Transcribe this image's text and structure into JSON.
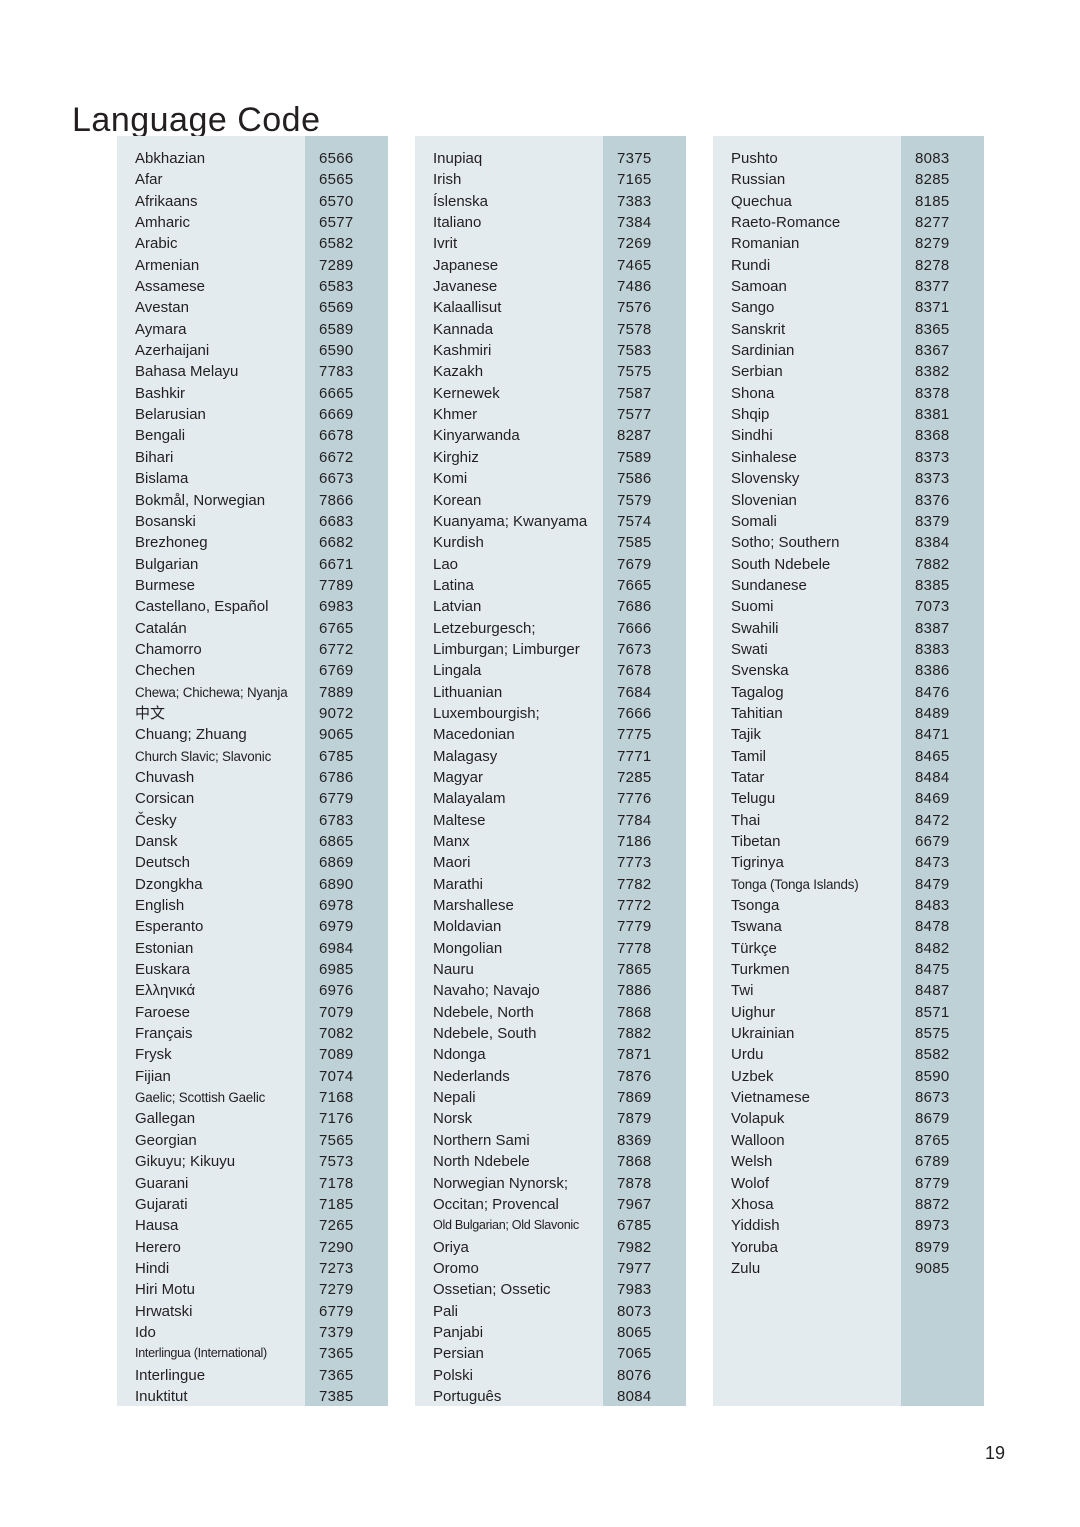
{
  "page": {
    "title": "Language Code",
    "page_number": "19",
    "colors": {
      "name_cell_bg": "#e3ebef",
      "code_cell_bg": "#bdd1d7",
      "text": "#231f20",
      "page_bg": "#ffffff"
    }
  },
  "table": {
    "columns": [
      {
        "id": "column-1",
        "rows": [
          {
            "name": "Abkhazian",
            "code": "6566"
          },
          {
            "name": "Afar",
            "code": "6565"
          },
          {
            "name": "Afrikaans",
            "code": "6570"
          },
          {
            "name": "Amharic",
            "code": "6577"
          },
          {
            "name": "Arabic",
            "code": "6582"
          },
          {
            "name": "Armenian",
            "code": "7289"
          },
          {
            "name": "Assamese",
            "code": "6583"
          },
          {
            "name": "Avestan",
            "code": "6569"
          },
          {
            "name": "Aymara",
            "code": "6589"
          },
          {
            "name": "Azerhaijani",
            "code": "6590"
          },
          {
            "name": "Bahasa Melayu",
            "code": "7783"
          },
          {
            "name": "Bashkir",
            "code": "6665"
          },
          {
            "name": "Belarusian",
            "code": "6669"
          },
          {
            "name": "Bengali",
            "code": "6678"
          },
          {
            "name": "Bihari",
            "code": "6672"
          },
          {
            "name": "Bislama",
            "code": "6673"
          },
          {
            "name": "Bokmål, Norwegian",
            "code": "7866"
          },
          {
            "name": "Bosanski",
            "code": "6683"
          },
          {
            "name": "Brezhoneg",
            "code": "6682"
          },
          {
            "name": "Bulgarian",
            "code": "6671"
          },
          {
            "name": "Burmese",
            "code": "7789"
          },
          {
            "name": "Castellano, Español",
            "code": "6983"
          },
          {
            "name": "Catalán",
            "code": "6765"
          },
          {
            "name": "Chamorro",
            "code": "6772"
          },
          {
            "name": "Chechen",
            "code": "6769"
          },
          {
            "name": "Chewa; Chichewa; Nyanja",
            "code": "7889"
          },
          {
            "name": "中文",
            "code": "9072"
          },
          {
            "name": "Chuang; Zhuang",
            "code": "9065"
          },
          {
            "name": "Church Slavic; Slavonic",
            "code": "6785"
          },
          {
            "name": "Chuvash",
            "code": "6786"
          },
          {
            "name": "Corsican",
            "code": "6779"
          },
          {
            "name": "Česky",
            "code": "6783"
          },
          {
            "name": "Dansk",
            "code": "6865"
          },
          {
            "name": "Deutsch",
            "code": "6869"
          },
          {
            "name": "Dzongkha",
            "code": "6890"
          },
          {
            "name": "English",
            "code": "6978"
          },
          {
            "name": "Esperanto",
            "code": "6979"
          },
          {
            "name": "Estonian",
            "code": "6984"
          },
          {
            "name": "Euskara",
            "code": "6985"
          },
          {
            "name": "Ελληνικά",
            "code": "6976"
          },
          {
            "name": "Faroese",
            "code": "7079"
          },
          {
            "name": "Français",
            "code": "7082"
          },
          {
            "name": "Frysk",
            "code": "7089"
          },
          {
            "name": "Fijian",
            "code": "7074"
          },
          {
            "name": "Gaelic; Scottish Gaelic",
            "code": "7168"
          },
          {
            "name": "Gallegan",
            "code": "7176"
          },
          {
            "name": "Georgian",
            "code": "7565"
          },
          {
            "name": "Gikuyu; Kikuyu",
            "code": "7573"
          },
          {
            "name": "Guarani",
            "code": "7178"
          },
          {
            "name": "Gujarati",
            "code": "7185"
          },
          {
            "name": "Hausa",
            "code": "7265"
          },
          {
            "name": "Herero",
            "code": "7290"
          },
          {
            "name": "Hindi",
            "code": "7273"
          },
          {
            "name": "Hiri Motu",
            "code": "7279"
          },
          {
            "name": "Hrwatski",
            "code": "6779"
          },
          {
            "name": "Ido",
            "code": "7379"
          },
          {
            "name": "Interlingua (International)",
            "code": "7365"
          },
          {
            "name": "Interlingue",
            "code": "7365"
          },
          {
            "name": "Inuktitut",
            "code": "7385"
          }
        ]
      },
      {
        "id": "column-2",
        "rows": [
          {
            "name": "Inupiaq",
            "code": "7375"
          },
          {
            "name": "Irish",
            "code": "7165"
          },
          {
            "name": "Íslenska",
            "code": "7383"
          },
          {
            "name": "Italiano",
            "code": "7384"
          },
          {
            "name": "Ivrit",
            "code": "7269"
          },
          {
            "name": "Japanese",
            "code": "7465"
          },
          {
            "name": "Javanese",
            "code": "7486"
          },
          {
            "name": "Kalaallisut",
            "code": "7576"
          },
          {
            "name": "Kannada",
            "code": "7578"
          },
          {
            "name": "Kashmiri",
            "code": "7583"
          },
          {
            "name": "Kazakh",
            "code": "7575"
          },
          {
            "name": "Kernewek",
            "code": "7587"
          },
          {
            "name": "Khmer",
            "code": "7577"
          },
          {
            "name": "Kinyarwanda",
            "code": "8287"
          },
          {
            "name": "Kirghiz",
            "code": "7589"
          },
          {
            "name": "Komi",
            "code": "7586"
          },
          {
            "name": "Korean",
            "code": "7579"
          },
          {
            "name": "Kuanyama; Kwanyama",
            "code": "7574"
          },
          {
            "name": "Kurdish",
            "code": "7585"
          },
          {
            "name": "Lao",
            "code": "7679"
          },
          {
            "name": "Latina",
            "code": "7665"
          },
          {
            "name": "Latvian",
            "code": "7686"
          },
          {
            "name": "Letzeburgesch;",
            "code": "7666"
          },
          {
            "name": "Limburgan; Limburger",
            "code": "7673"
          },
          {
            "name": "Lingala",
            "code": "7678"
          },
          {
            "name": "Lithuanian",
            "code": "7684"
          },
          {
            "name": "Luxembourgish;",
            "code": "7666"
          },
          {
            "name": "Macedonian",
            "code": "7775"
          },
          {
            "name": "Malagasy",
            "code": "7771"
          },
          {
            "name": "Magyar",
            "code": "7285"
          },
          {
            "name": "Malayalam",
            "code": "7776"
          },
          {
            "name": "Maltese",
            "code": "7784"
          },
          {
            "name": "Manx",
            "code": "7186"
          },
          {
            "name": "Maori",
            "code": "7773"
          },
          {
            "name": "Marathi",
            "code": "7782"
          },
          {
            "name": "Marshallese",
            "code": "7772"
          },
          {
            "name": "Moldavian",
            "code": "7779"
          },
          {
            "name": "Mongolian",
            "code": "7778"
          },
          {
            "name": "Nauru",
            "code": "7865"
          },
          {
            "name": "Navaho; Navajo",
            "code": "7886"
          },
          {
            "name": "Ndebele, North",
            "code": "7868"
          },
          {
            "name": "Ndebele, South",
            "code": "7882"
          },
          {
            "name": "Ndonga",
            "code": "7871"
          },
          {
            "name": "Nederlands",
            "code": "7876"
          },
          {
            "name": "Nepali",
            "code": "7869"
          },
          {
            "name": "Norsk",
            "code": "7879"
          },
          {
            "name": "Northern Sami",
            "code": "8369"
          },
          {
            "name": "North Ndebele",
            "code": "7868"
          },
          {
            "name": "Norwegian Nynorsk;",
            "code": "7878"
          },
          {
            "name": "Occitan; Provencal",
            "code": "7967"
          },
          {
            "name": "Old Bulgarian; Old Slavonic",
            "code": "6785"
          },
          {
            "name": "Oriya",
            "code": "7982"
          },
          {
            "name": "Oromo",
            "code": "7977"
          },
          {
            "name": "Ossetian; Ossetic",
            "code": "7983"
          },
          {
            "name": "Pali",
            "code": "8073"
          },
          {
            "name": "Panjabi",
            "code": "8065"
          },
          {
            "name": "Persian",
            "code": "7065"
          },
          {
            "name": "Polski",
            "code": "8076"
          },
          {
            "name": "Português",
            "code": "8084"
          }
        ]
      },
      {
        "id": "column-3",
        "rows": [
          {
            "name": "Pushto",
            "code": "8083"
          },
          {
            "name": "Russian",
            "code": "8285"
          },
          {
            "name": "Quechua",
            "code": "8185"
          },
          {
            "name": "Raeto-Romance",
            "code": "8277"
          },
          {
            "name": "Romanian",
            "code": "8279"
          },
          {
            "name": "Rundi",
            "code": "8278"
          },
          {
            "name": "Samoan",
            "code": "8377"
          },
          {
            "name": "Sango",
            "code": "8371"
          },
          {
            "name": "Sanskrit",
            "code": "8365"
          },
          {
            "name": "Sardinian",
            "code": "8367"
          },
          {
            "name": "Serbian",
            "code": "8382"
          },
          {
            "name": "Shona",
            "code": "8378"
          },
          {
            "name": "Shqip",
            "code": "8381"
          },
          {
            "name": "Sindhi",
            "code": "8368"
          },
          {
            "name": "Sinhalese",
            "code": "8373"
          },
          {
            "name": "Slovensky",
            "code": "8373"
          },
          {
            "name": "Slovenian",
            "code": "8376"
          },
          {
            "name": "Somali",
            "code": "8379"
          },
          {
            "name": "Sotho; Southern",
            "code": "8384"
          },
          {
            "name": "South Ndebele",
            "code": "7882"
          },
          {
            "name": "Sundanese",
            "code": "8385"
          },
          {
            "name": "Suomi",
            "code": "7073"
          },
          {
            "name": "Swahili",
            "code": "8387"
          },
          {
            "name": "Swati",
            "code": "8383"
          },
          {
            "name": "Svenska",
            "code": "8386"
          },
          {
            "name": "Tagalog",
            "code": "8476"
          },
          {
            "name": "Tahitian",
            "code": "8489"
          },
          {
            "name": "Tajik",
            "code": "8471"
          },
          {
            "name": "Tamil",
            "code": "8465"
          },
          {
            "name": "Tatar",
            "code": "8484"
          },
          {
            "name": "Telugu",
            "code": "8469"
          },
          {
            "name": "Thai",
            "code": "8472"
          },
          {
            "name": "Tibetan",
            "code": "6679"
          },
          {
            "name": "Tigrinya",
            "code": "8473"
          },
          {
            "name": "Tonga (Tonga Islands)",
            "code": "8479"
          },
          {
            "name": "Tsonga",
            "code": "8483"
          },
          {
            "name": "Tswana",
            "code": "8478"
          },
          {
            "name": "Türkçe",
            "code": "8482"
          },
          {
            "name": "Turkmen",
            "code": "8475"
          },
          {
            "name": "Twi",
            "code": "8487"
          },
          {
            "name": "Uighur",
            "code": "8571"
          },
          {
            "name": "Ukrainian",
            "code": "8575"
          },
          {
            "name": "Urdu",
            "code": "8582"
          },
          {
            "name": "Uzbek",
            "code": "8590"
          },
          {
            "name": "Vietnamese",
            "code": "8673"
          },
          {
            "name": "Volapuk",
            "code": "8679"
          },
          {
            "name": "Walloon",
            "code": "8765"
          },
          {
            "name": "Welsh",
            "code": "6789"
          },
          {
            "name": "Wolof",
            "code": "8779"
          },
          {
            "name": "Xhosa",
            "code": "8872"
          },
          {
            "name": "Yiddish",
            "code": "8973"
          },
          {
            "name": "Yoruba",
            "code": "8979"
          },
          {
            "name": "Zulu",
            "code": "9085"
          }
        ]
      }
    ]
  }
}
